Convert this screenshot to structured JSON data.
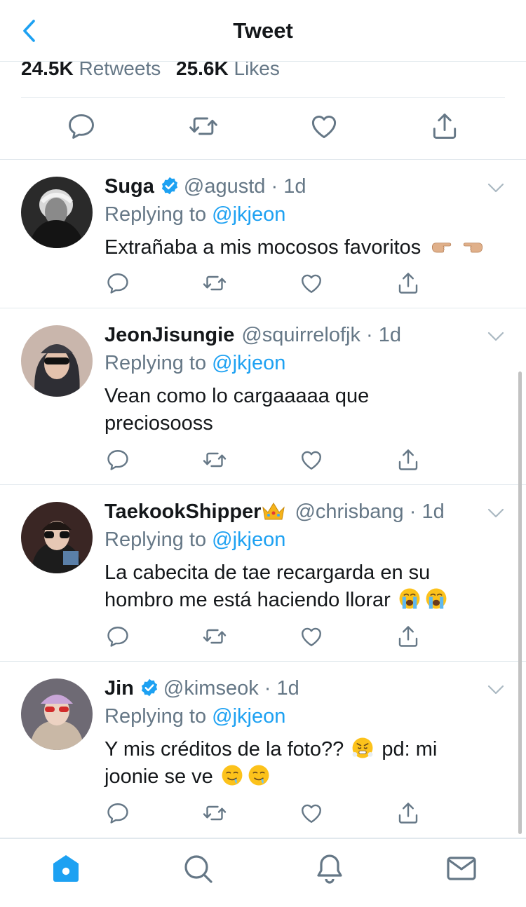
{
  "header": {
    "title": "Tweet",
    "back_icon": "chevron-left-icon"
  },
  "stats": {
    "retweets_count": "24.5K",
    "retweets_label": "Retweets",
    "likes_count": "25.6K",
    "likes_label": "Likes"
  },
  "replying_label": "Replying to",
  "replies": [
    {
      "name": "Suga",
      "verified": true,
      "handle": "@agustd",
      "time": "1d",
      "mention": "@jkjeon",
      "text": "Extrañaba a mis mocosos favoritos",
      "emojis": [
        "backhand-index-right",
        "backhand-index-left"
      ]
    },
    {
      "name": "JeonJisungie",
      "verified": false,
      "handle": "@squirrelofjk",
      "time": "1d",
      "mention": "@jkjeon",
      "text_line1": "Vean como lo cargaaaaa que",
      "text_line2": "preciosooss"
    },
    {
      "name": "TaekookShipper",
      "verified": false,
      "name_emoji": "crown",
      "handle": "@chrisbang",
      "time": "1d",
      "mention": "@jkjeon",
      "text_line1": "La cabecita de tae recargarda en su",
      "text_line2": "hombro me está haciendo llorar",
      "emojis": [
        "loudly-crying-face",
        "loudly-crying-face"
      ]
    },
    {
      "name": "Jin",
      "verified": true,
      "handle": "@kimseok",
      "time": "1d",
      "mention": "@jkjeon",
      "text_line1a": "Y mis créditos de la foto??",
      "text_line1b": "pd: mi",
      "text_line2": "joonie se ve",
      "emojis": [
        "face-with-steam",
        "drooling-face",
        "drooling-face"
      ]
    }
  ],
  "tabs": [
    "home-icon",
    "search-icon",
    "notifications-bell-icon",
    "messages-envelope-icon"
  ],
  "colors": {
    "accent": "#1da1f2",
    "text": "#14171a",
    "secondary": "#657786",
    "divider": "#e1e8ed"
  }
}
